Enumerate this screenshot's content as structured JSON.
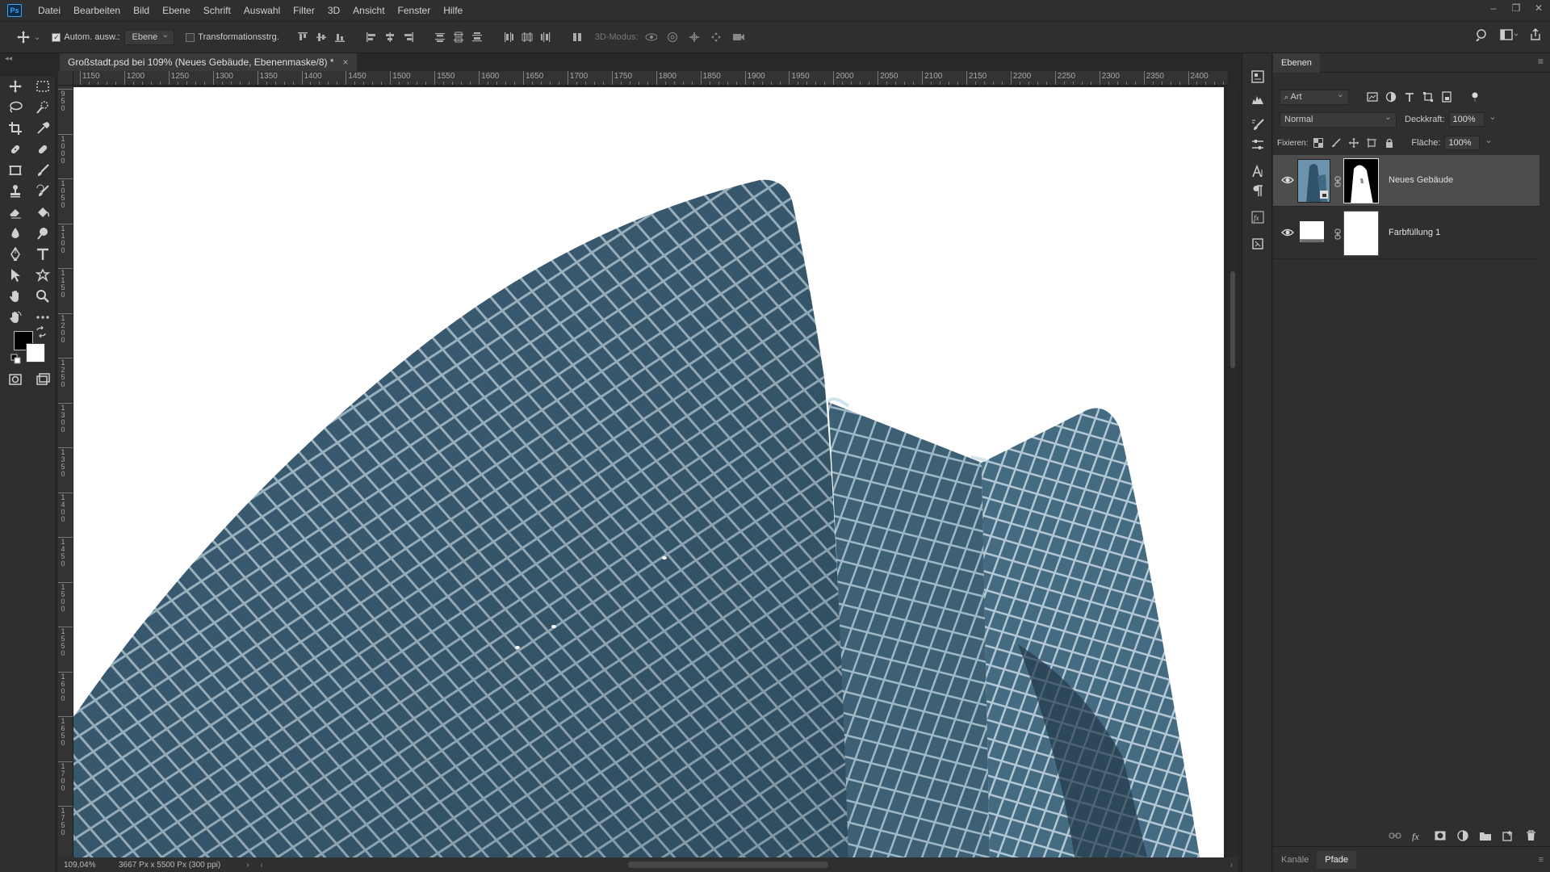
{
  "app": {
    "logo_text": "Ps"
  },
  "menu": [
    "Datei",
    "Bearbeiten",
    "Bild",
    "Ebene",
    "Schrift",
    "Auswahl",
    "Filter",
    "3D",
    "Ansicht",
    "Fenster",
    "Hilfe"
  ],
  "window_controls": {
    "minimize": "–",
    "restore": "❐",
    "close": "✕"
  },
  "options_bar": {
    "auto_select_label": "Autom. ausw.:",
    "auto_select_checked": true,
    "auto_select_target": "Ebene",
    "transform_controls_label": "Transformationsstrg.",
    "transform_controls_checked": false,
    "mode_3d_label": "3D-Modus:"
  },
  "document_tab": {
    "title": "Großstadt.psd bei 109% (Neues Gebäude, Ebenenmaske/8) *",
    "close": "×"
  },
  "ruler": {
    "top_labels": [
      "1150",
      "1200",
      "1250",
      "1300",
      "1350",
      "1400",
      "1450",
      "1500",
      "1550",
      "1600",
      "1650",
      "1700",
      "1750",
      "1800",
      "1850",
      "1900",
      "1950",
      "2000",
      "2050",
      "2100",
      "2150",
      "2200",
      "2250",
      "2300",
      "2350",
      "2400"
    ],
    "left_labels": [
      "950",
      "1000",
      "1050",
      "1100",
      "1150",
      "1200",
      "1250",
      "1300",
      "1350",
      "1400",
      "1450",
      "1500",
      "1550",
      "1600",
      "1650",
      "1700",
      "1750"
    ]
  },
  "status_bar": {
    "zoom": "109,04%",
    "doc_info": "3667 Px x 5500 Px (300 ppi)",
    "arrow": "›"
  },
  "layers_panel": {
    "tab_label": "Ebenen",
    "filter_kind": "Art",
    "blend_mode": "Normal",
    "opacity_label": "Deckkraft:",
    "opacity_value": "100%",
    "lock_label": "Fixieren:",
    "fill_label": "Fläche:",
    "fill_value": "100%",
    "layers": [
      {
        "name": "Neues Gebäude",
        "visible": true,
        "selected": true,
        "has_mask": true
      },
      {
        "name": "Farbfüllung 1",
        "visible": true,
        "selected": false,
        "has_mask": true
      }
    ],
    "bottom_tabs": [
      "Kanäle",
      "Pfade"
    ],
    "active_bottom_tab": "Pfade"
  },
  "colors": {
    "foreground": "#000000",
    "background": "#ffffff",
    "ui_panel": "#2f2f2f",
    "ui_dark": "#282828",
    "accent": "#31a8ff",
    "building_glass": "#3b5f78"
  }
}
